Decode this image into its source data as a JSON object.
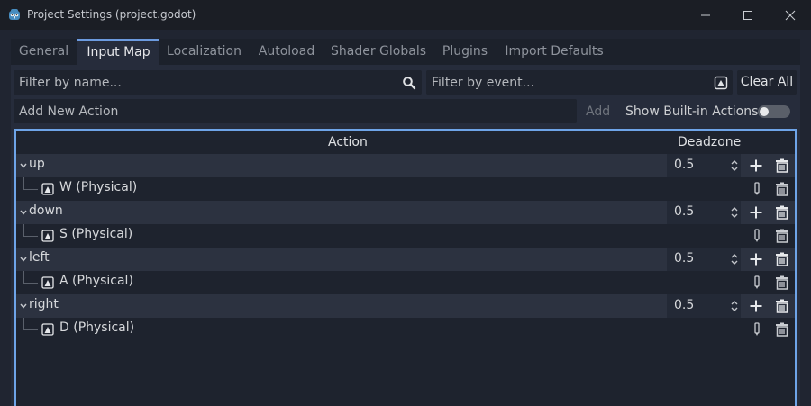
{
  "window": {
    "title": "Project Settings (project.godot)",
    "accent": "#6ea4e8"
  },
  "tabs": [
    "General",
    "Input Map",
    "Localization",
    "Autoload",
    "Shader Globals",
    "Plugins",
    "Import Defaults"
  ],
  "active_tab": "Input Map",
  "filter_name": {
    "placeholder": "Filter by name..."
  },
  "filter_event": {
    "placeholder": "Filter by event..."
  },
  "clear_all_label": "Clear All",
  "new_action": {
    "placeholder": "Add New Action"
  },
  "add_label": "Add",
  "show_builtin_label": "Show Built-in Actions",
  "show_builtin_on": false,
  "table": {
    "header_action": "Action",
    "header_deadzone": "Deadzone",
    "actions": [
      {
        "name": "up",
        "deadzone": "0.5",
        "event": "W (Physical)"
      },
      {
        "name": "down",
        "deadzone": "0.5",
        "event": "S (Physical)"
      },
      {
        "name": "left",
        "deadzone": "0.5",
        "event": "A (Physical)"
      },
      {
        "name": "right",
        "deadzone": "0.5",
        "event": "D (Physical)"
      }
    ]
  }
}
